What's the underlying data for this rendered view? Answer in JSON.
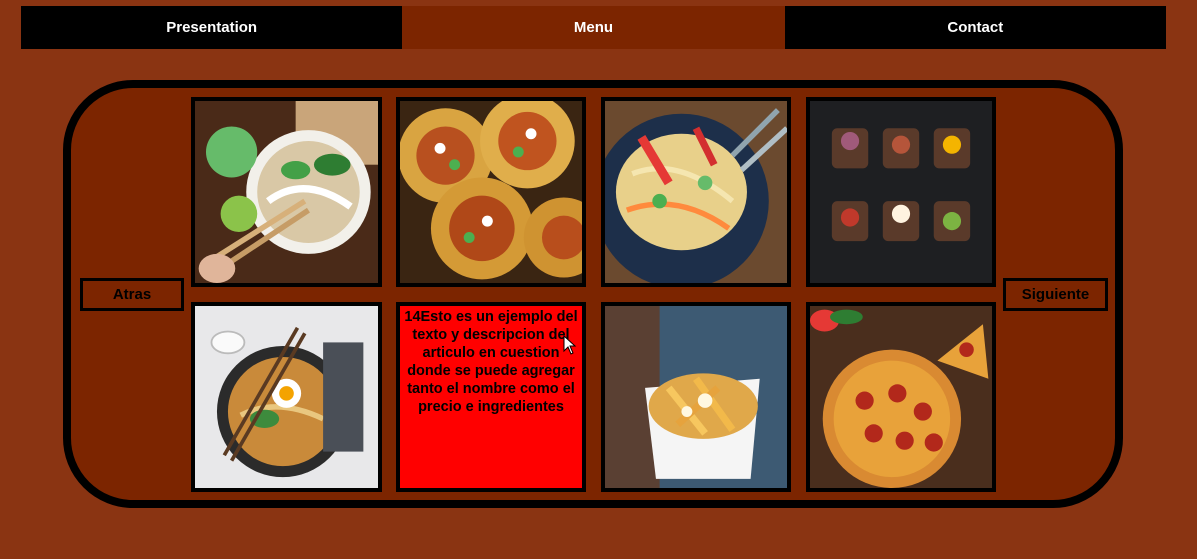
{
  "nav": {
    "items": [
      {
        "label": "Presentation"
      },
      {
        "label": "Menu"
      },
      {
        "label": "Contact"
      }
    ],
    "active_index": 1
  },
  "carousel": {
    "prev_label": "Atras",
    "next_label": "Siguiente",
    "tiles": [
      {
        "kind": "image",
        "icon": "pho-noodle-soup-photo"
      },
      {
        "kind": "image",
        "icon": "tacos-photo"
      },
      {
        "kind": "image",
        "icon": "papaya-salad-photo"
      },
      {
        "kind": "image",
        "icon": "open-sandwiches-photo"
      },
      {
        "kind": "image",
        "icon": "ramen-bowl-photo"
      },
      {
        "kind": "text",
        "text": "14Esto es un ejemplo del texto y descripcion del articulo en cuestion donde se puede agregar tanto el nombre como el precio e ingredientes"
      },
      {
        "kind": "image",
        "icon": "poutine-fries-photo"
      },
      {
        "kind": "image",
        "icon": "pepperoni-pizza-photo"
      }
    ]
  },
  "colors": {
    "page_bg": "#8a3412",
    "panel_bg": "#7c2500",
    "nav_bg": "#000000",
    "description_bg": "#ff0000"
  }
}
